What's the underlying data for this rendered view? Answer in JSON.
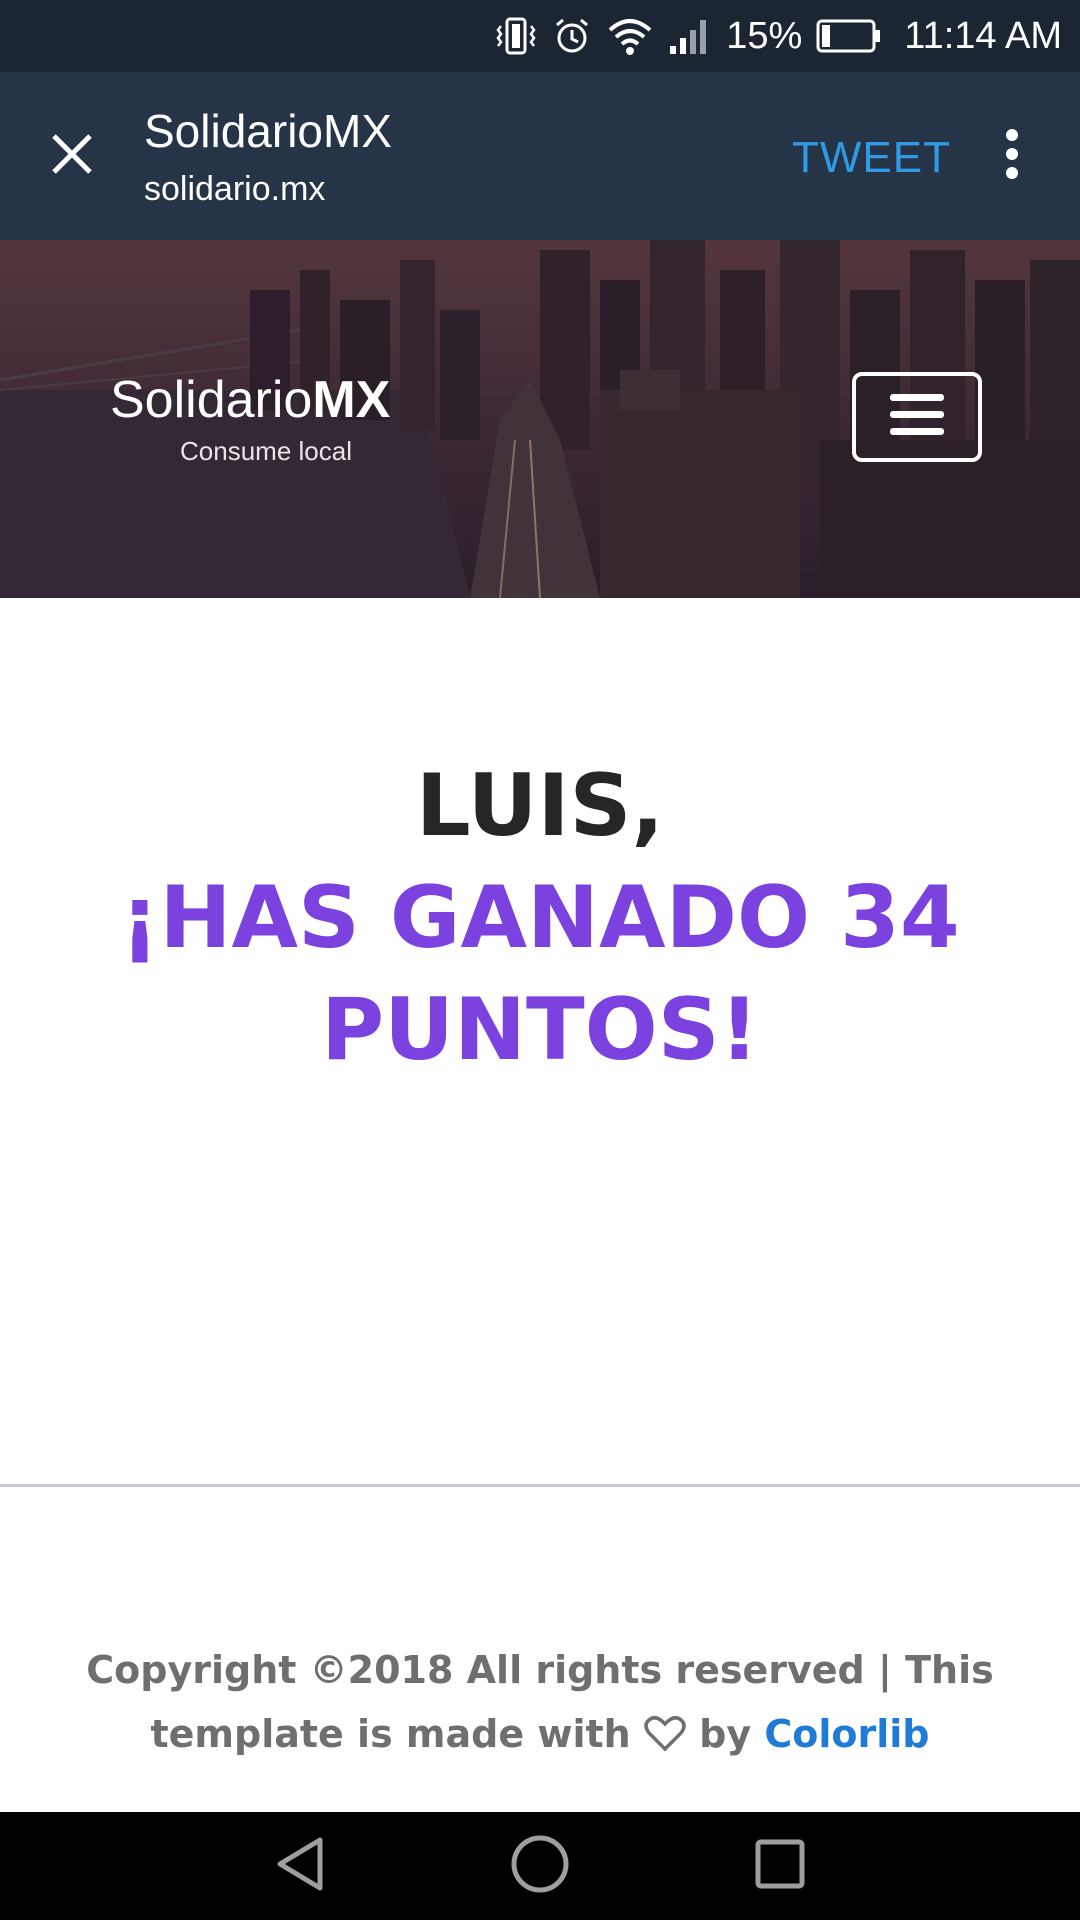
{
  "status_bar": {
    "battery": "15%",
    "time": "11:14 AM",
    "icons": [
      "vibrate-icon",
      "alarm-icon",
      "wifi-icon",
      "signal-icon",
      "battery-icon"
    ]
  },
  "browser": {
    "title": "SolidarioMX",
    "url": "solidario.mx",
    "tweet_label": "TWEET",
    "accent_color": "#2f9be6"
  },
  "hero": {
    "logo_regular": "Solidario",
    "logo_bold": "MX",
    "tagline": "Consume local"
  },
  "message": {
    "name_line": "LUIS,",
    "points_line": "¡HAS GANADO 34 PUNTOS!",
    "accent_color": "#7b42e0"
  },
  "footer": {
    "line1": "Copyright ©2018 All rights reserved | This",
    "line2_before": "template is made with",
    "line2_by": "by",
    "link_text": "Colorlib"
  }
}
